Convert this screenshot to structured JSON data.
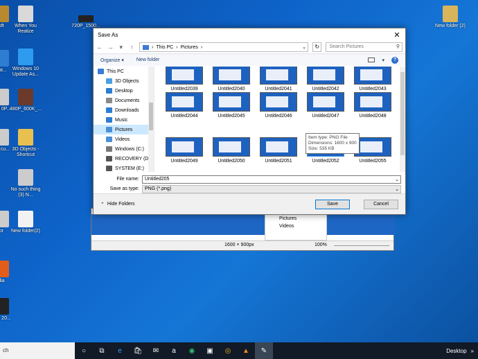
{
  "desktop": {
    "icons": [
      {
        "label": "oft",
        "color": "#b98a2d"
      },
      {
        "label": "When You Realize",
        "color": "#d9d9d9"
      },
      {
        "label": "720P_1500...",
        "color": "#222"
      },
      {
        "label": "New folder (2)",
        "color": "#d9b45a"
      },
      {
        "label": "eat...",
        "color": "#2d7dd2"
      },
      {
        "label": "Windows 10 Update As...",
        "color": "#2d9cf0"
      },
      {
        "label": "mal 0P...",
        "color": "#ccc"
      },
      {
        "label": "480P_600K_...",
        "color": "#6b3a2a"
      },
      {
        "label": "chi cu...",
        "color": "#ccc"
      },
      {
        "label": "3D Objects - Shortcut",
        "color": "#e8c050"
      },
      {
        "label": "No such thing (3) N...",
        "color": "#ccc"
      },
      {
        "label": "or",
        "color": "#ccc"
      },
      {
        "label": "New folder(2)",
        "color": "#f2f2f2"
      },
      {
        "label": "dia",
        "color": "#e25d1a"
      },
      {
        "label": "The 20...",
        "color": "#222"
      }
    ]
  },
  "background_window": {
    "sidebar_items": [
      "Pictures",
      "Videos"
    ],
    "status_dimensions": "1600 × 900px",
    "zoom": "100%"
  },
  "dialog": {
    "title": "Save As",
    "close_glyph": "✕",
    "address": {
      "crumbs": [
        "This PC",
        "Pictures"
      ],
      "separator": "›"
    },
    "search_placeholder": "Search Pictures",
    "toolbar": {
      "organize": "Organize ▾",
      "new_folder": "New folder",
      "help": "?"
    },
    "nav_items": [
      {
        "label": "This PC",
        "color": "#3a7bd5",
        "selected": false
      },
      {
        "label": "3D Objects",
        "color": "#4aa0e6",
        "selected": false
      },
      {
        "label": "Desktop",
        "color": "#2d7dd2",
        "selected": false
      },
      {
        "label": "Documents",
        "color": "#8a8a8a",
        "selected": false
      },
      {
        "label": "Downloads",
        "color": "#2d7dd2",
        "selected": false
      },
      {
        "label": "Music",
        "color": "#2d7dd2",
        "selected": false
      },
      {
        "label": "Pictures",
        "color": "#4a8fd8",
        "selected": true
      },
      {
        "label": "Videos",
        "color": "#4a8fd8",
        "selected": false
      },
      {
        "label": "Windows (C:)",
        "color": "#777",
        "selected": false
      },
      {
        "label": "RECOVERY (D:)",
        "color": "#555",
        "selected": false
      },
      {
        "label": "SYSTEM (E:)",
        "color": "#555",
        "selected": false
      }
    ],
    "files": [
      "Untitled2039",
      "Untitled2040",
      "Untitled2041",
      "Untitled2042",
      "Untitled2043",
      "Untitled2044",
      "Untitled2045",
      "Untitled2046",
      "Untitled2047",
      "Untitled2048",
      "Untitled2049",
      "Untitled2050",
      "Untitled2051",
      "Untitled2052",
      "Untitled2055"
    ],
    "tooltip": [
      "Item type: PNG File",
      "Dimensions: 1600 x 900",
      "Size: 535 KB"
    ],
    "file_name_label": "File name:",
    "file_name_value": "Untitled205",
    "save_type_label": "Save as type:",
    "save_type_value": "PNG (*.png)",
    "hide_folders": "Hide Folders",
    "save_button": "Save",
    "cancel_button": "Cancel"
  },
  "taskbar": {
    "search_text": "ch",
    "right_label": "Desktop",
    "more": "»"
  }
}
